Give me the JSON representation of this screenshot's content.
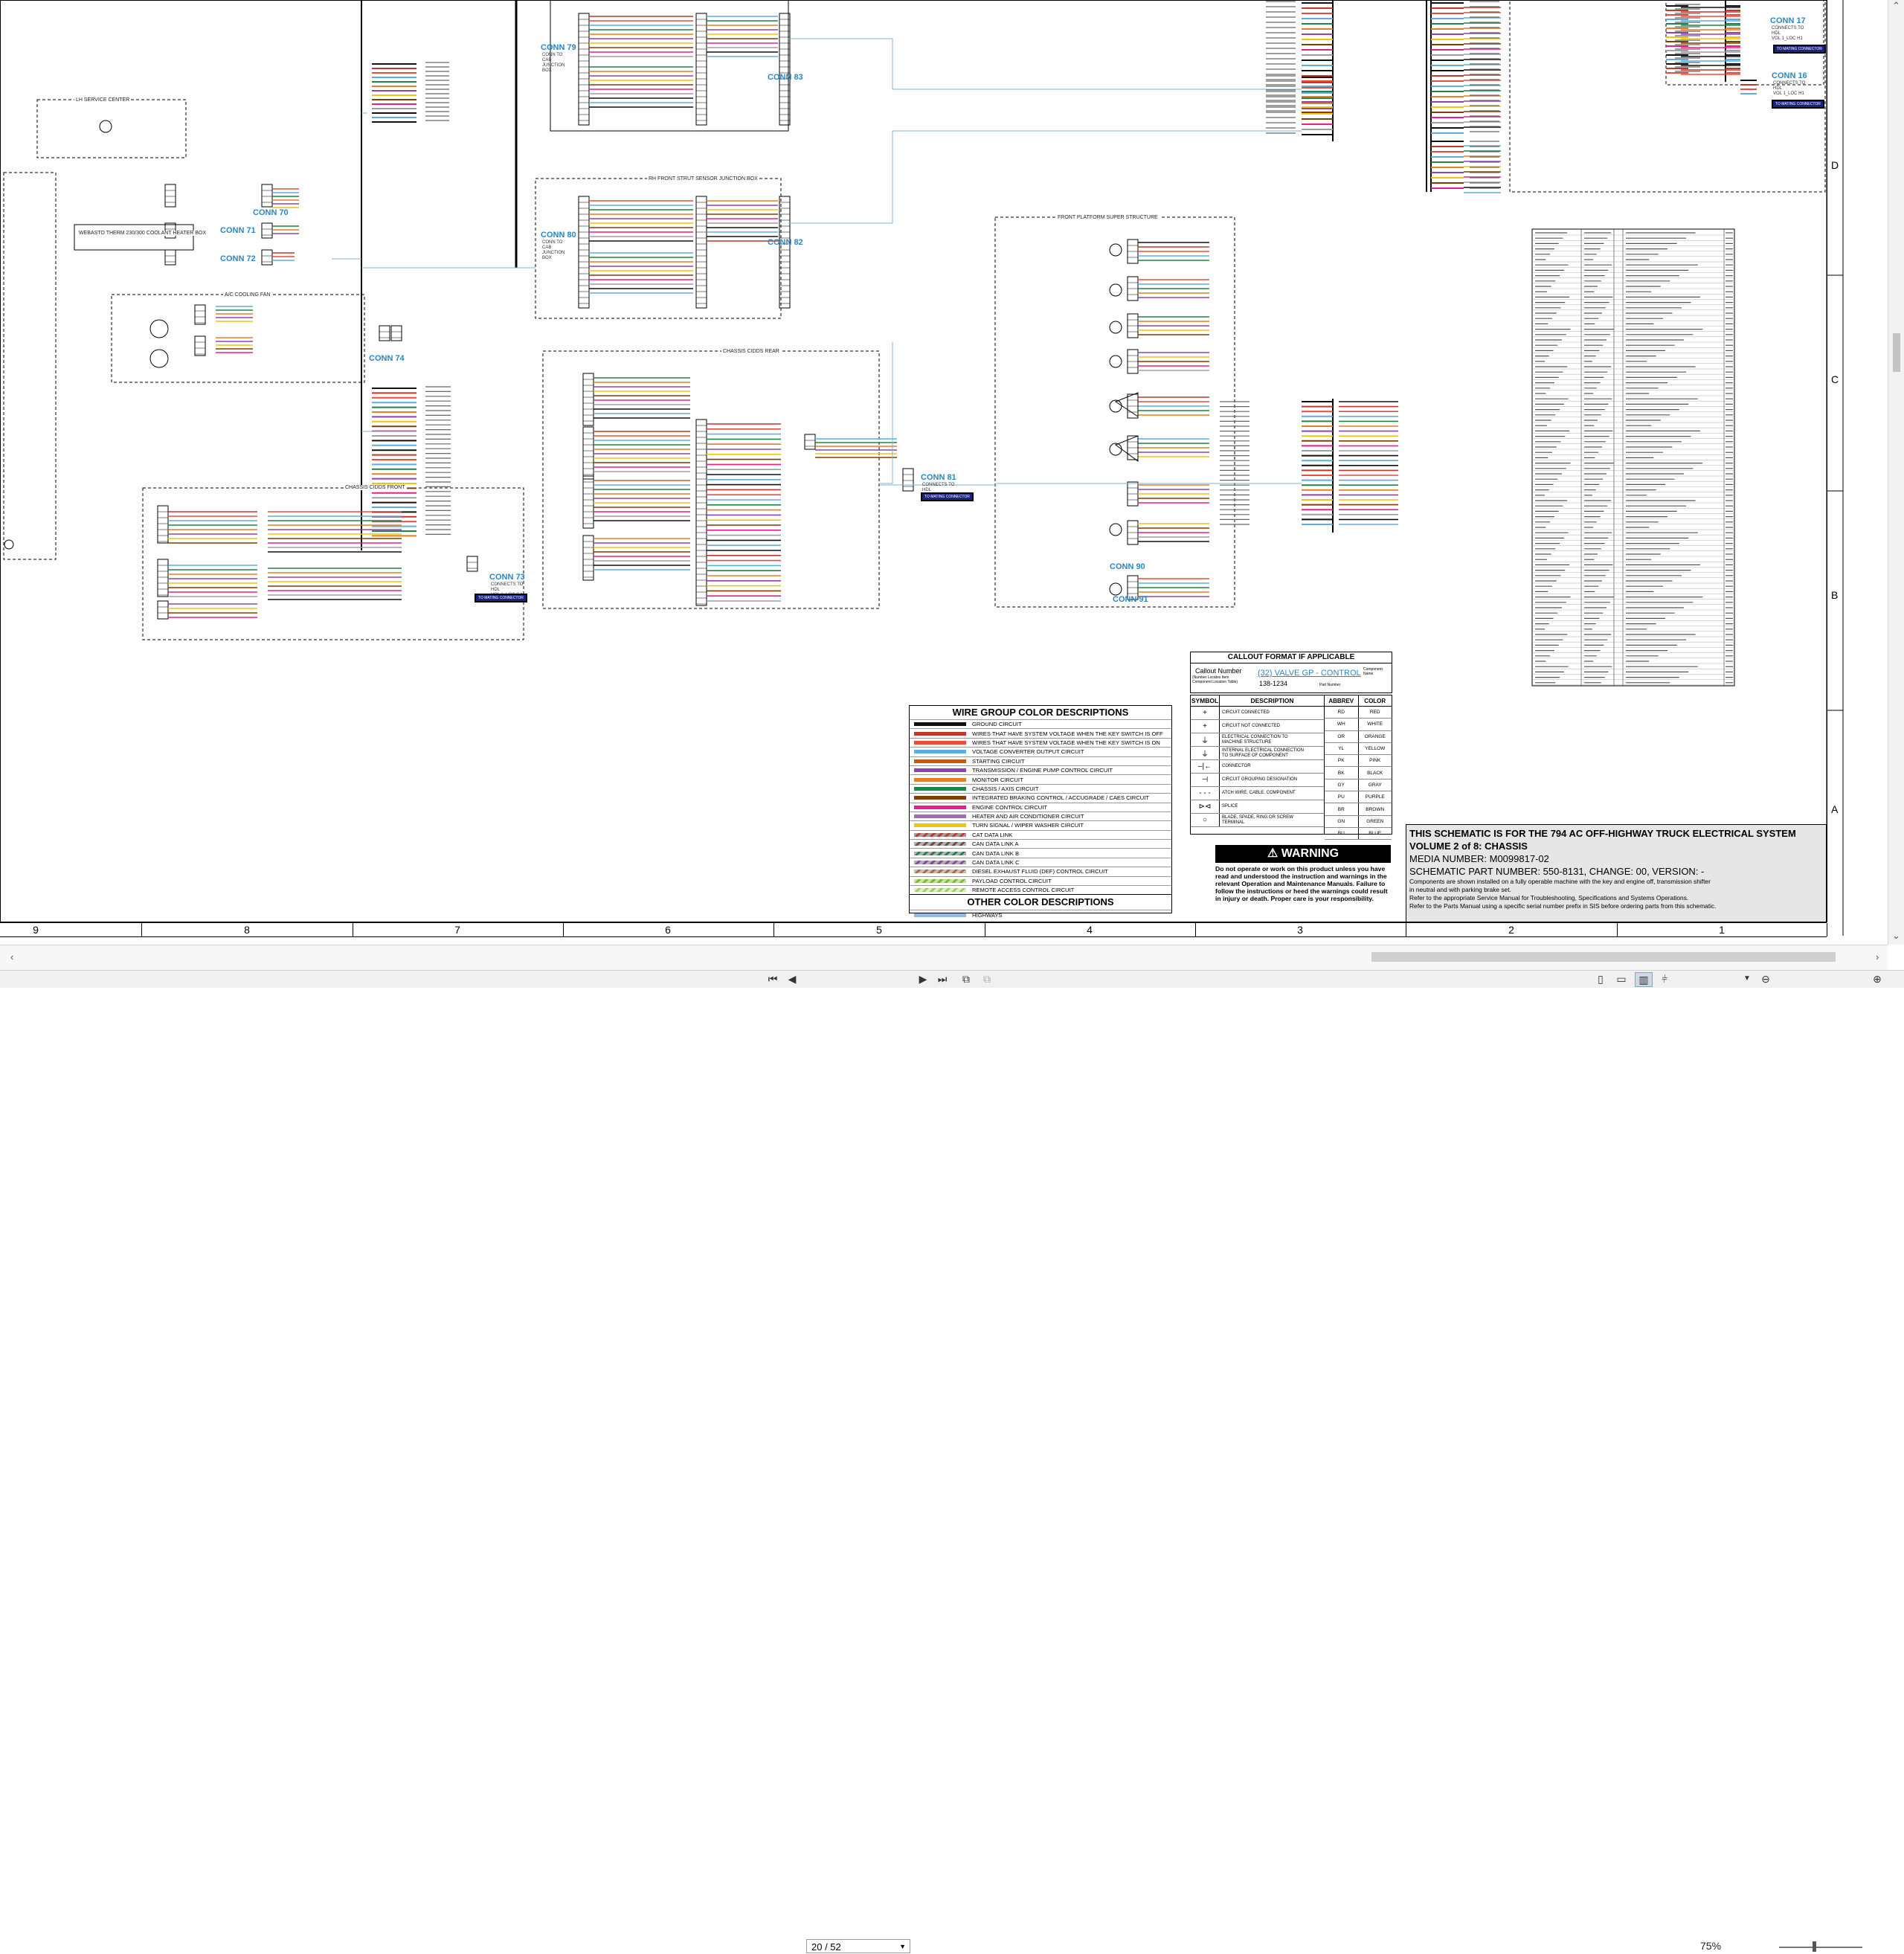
{
  "viewer": {
    "page_indicator": "20 / 52",
    "zoom": "75%",
    "nav_icons": [
      "first-page-icon",
      "prev-page-icon",
      "next-page-icon",
      "last-page-icon"
    ]
  },
  "schematic": {
    "connectors": [
      {
        "id": "c79",
        "label": "CONN 79",
        "sub": "CONN TO\nCAB\nJUNCTION\nBOX"
      },
      {
        "id": "c83",
        "label": "CONN 83",
        "sub": ""
      },
      {
        "id": "c80",
        "label": "CONN 80",
        "sub": "CONN TO\nCAB\nJUNCTION\nBOX"
      },
      {
        "id": "c82",
        "label": "CONN 82",
        "sub": ""
      },
      {
        "id": "c70",
        "label": "CONN 70",
        "sub": ""
      },
      {
        "id": "c71",
        "label": "CONN 71",
        "sub": ""
      },
      {
        "id": "c72",
        "label": "CONN 72",
        "sub": ""
      },
      {
        "id": "c74",
        "label": "CONN 74",
        "sub": ""
      },
      {
        "id": "c73",
        "label": "CONN 73",
        "sub": "CONNECTS TO\nHDL\nVOL 1_LOC G4"
      },
      {
        "id": "c81",
        "label": "CONN 81",
        "sub": "CONNECTS TO\nHDL\nVOL 1_LOC C4"
      },
      {
        "id": "c90",
        "label": "CONN 90",
        "sub": ""
      },
      {
        "id": "c91",
        "label": "CONN 91",
        "sub": ""
      },
      {
        "id": "c17",
        "label": "CONN 17",
        "sub": "CONNECTS TO\nHDL\nVOL 1_LOC H1"
      },
      {
        "id": "c16",
        "label": "CONN 16",
        "sub": "CONNECTS TO\nHDL\nVOL 1_LOC H1"
      }
    ],
    "badge_text": "TO MATING CONNECTOR",
    "box_titles": {
      "lh_service_center": "LH SERVICE CENTER",
      "ac_cooling_fan": "A/C COOLING FAN",
      "chassis_cids_front": "CHASSIS CIDDS FRONT",
      "chassis_cids_rear": "CHASSIS CIDDS REAR",
      "rh_front_strut": "RH FRONT STRUT SENSOR JUNCTION BOX",
      "front_platform": "FRONT PLATFORM SUPER STRUCTURE",
      "webasto": "WEBASTO THERM 230/300 COOLANT HEATER BOX"
    }
  },
  "legend": {
    "title": "WIRE GROUP COLOR DESCRIPTIONS",
    "items": [
      {
        "label": "GROUND CIRCUIT",
        "color": "#111111"
      },
      {
        "label": "WIRES THAT HAVE SYSTEM VOLTAGE WHEN THE KEY SWITCH IS OFF",
        "color": "#c0392b"
      },
      {
        "label": "WIRES THAT HAVE SYSTEM VOLTAGE WHEN THE KEY SWITCH IS ON",
        "color": "#e74c3c"
      },
      {
        "label": "VOLTAGE CONVERTER OUTPUT CIRCUIT",
        "color": "#5dade2"
      },
      {
        "label": "STARTING CIRCUIT",
        "color": "#d35400"
      },
      {
        "label": "TRANSMISSION / ENGINE PUMP CONTROL CIRCUIT",
        "color": "#8e44ad"
      },
      {
        "label": "MONITOR CIRCUIT",
        "color": "#e67e22"
      },
      {
        "label": "CHASSIS / AXIS CIRCUIT",
        "color": "#1e8449"
      },
      {
        "label": "INTEGRATED BRAKING CONTROL / ACCUGRADE / CAES CIRCUIT",
        "color": "#7b3f00"
      },
      {
        "label": "ENGINE CONTROL CIRCUIT",
        "color": "#e91e8c"
      },
      {
        "label": "HEATER AND AIR CONDITIONER CIRCUIT",
        "color": "#a569bd"
      },
      {
        "label": "TURN SIGNAL / WIPER WASHER CIRCUIT",
        "color": "#f1c40f"
      },
      {
        "label": "CAT DATA LINK",
        "color": "#9e9e9e",
        "pattern": "#c0392b"
      },
      {
        "label": "CAN DATA LINK A",
        "color": "#b0b0b0",
        "pattern": "#6d4c41"
      },
      {
        "label": "CAN DATA LINK B",
        "color": "#b0b0b0",
        "pattern": "#1e8449"
      },
      {
        "label": "CAN DATA LINK C",
        "color": "#b0b0b0",
        "pattern": "#8e44ad"
      },
      {
        "label": "DIESEL EXHAUST FLUID (DEF) CONTROL CIRCUIT",
        "color": "#d5b9a0",
        "pattern": "#a66"
      },
      {
        "label": "PAYLOAD CONTROL CIRCUIT",
        "color": "#c5e1a5",
        "pattern": "#7cb342"
      },
      {
        "label": "REMOTE ACCESS CONTROL CIRCUIT",
        "color": "#dcedc8",
        "pattern": "#9ccc65"
      }
    ],
    "other_title": "OTHER COLOR DESCRIPTIONS",
    "other_items": [
      {
        "label": "HIGHWAYS",
        "color": "#90b8e0"
      }
    ]
  },
  "callout": {
    "title": "CALLOUT FORMAT IF APPLICABLE",
    "callout_number": "Callout Number",
    "callout_note": "(Number Locates Item\nComponent Location Table)",
    "example": "(32) VALVE GP - CONTROL",
    "part_number": "138-1234",
    "component_name": "Component\nName",
    "part_label": "Part Number"
  },
  "symbols": {
    "col_symbol": "SYMBOL",
    "col_description": "DESCRIPTION",
    "rows": [
      {
        "symbol": "+",
        "description": "CIRCUIT CONNECTED"
      },
      {
        "symbol": "+",
        "description": "CIRCUIT NOT CONNECTED"
      },
      {
        "symbol": "⏚",
        "description": "ELECTRICAL CONNECTION TO\nMACHINE STRUCTURE"
      },
      {
        "symbol": "⏚",
        "description": "INTERNAL ELECTRICAL CONNECTION\nTO SURFACE OF COMPONENT"
      },
      {
        "symbol": "–|←",
        "description": "CONNECTOR"
      },
      {
        "symbol": "⊣",
        "description": "CIRCUIT GROUPING DESIGNATION"
      },
      {
        "symbol": "- - -",
        "description": "ATCH WIRE, CABLE, COMPONENT"
      },
      {
        "symbol": "⊳⊲",
        "description": "SPLICE"
      },
      {
        "symbol": "○",
        "description": "BLADE, SPADE, RING OR SCREW\nTERMINAL"
      }
    ]
  },
  "abbreviations": {
    "col_abbrev": "ABBREV",
    "col_color": "COLOR",
    "rows": [
      {
        "abbrev": "RD",
        "color": "RED"
      },
      {
        "abbrev": "WH",
        "color": "WHITE"
      },
      {
        "abbrev": "OR",
        "color": "ORANGE"
      },
      {
        "abbrev": "YL",
        "color": "YELLOW"
      },
      {
        "abbrev": "PK",
        "color": "PINK"
      },
      {
        "abbrev": "BK",
        "color": "BLACK"
      },
      {
        "abbrev": "GY",
        "color": "GRAY"
      },
      {
        "abbrev": "PU",
        "color": "PURPLE"
      },
      {
        "abbrev": "BR",
        "color": "BROWN"
      },
      {
        "abbrev": "GN",
        "color": "GREEN"
      },
      {
        "abbrev": "BU",
        "color": "BLUE"
      }
    ]
  },
  "warning": {
    "title": "WARNING",
    "text": "Do not operate or work on this product unless you have read and understood the instruction and warnings in the relevant Operation and Maintenance Manuals. Failure to follow the instructions or heed the warnings could result in injury or death. Proper care is your responsibility."
  },
  "title_block": {
    "line1": "THIS SCHEMATIC IS FOR THE 794 AC OFF-HIGHWAY TRUCK ELECTRICAL SYSTEM",
    "line2": "VOLUME 2 of 8: CHASSIS",
    "line3": "MEDIA NUMBER: M0099817-02",
    "line4": "SCHEMATIC PART NUMBER: 550-8131, CHANGE: 00, VERSION: -",
    "note1": "Components are shown installed on a fully operable machine with the key and engine off, transmission shifter",
    "note2": "in neutral and with parking brake set.",
    "note3": "Refer to the appropriate Service Manual for Troubleshooting, Specifications and Systems Operations.",
    "note4": "Refer to the Parts Manual using a specific serial number prefix in SIS before ordering parts from this schematic."
  },
  "zones": {
    "columns": [
      "9",
      "8",
      "7",
      "6",
      "5",
      "4",
      "3",
      "2",
      "1"
    ],
    "rows": [
      "D",
      "C",
      "B",
      "A"
    ]
  }
}
